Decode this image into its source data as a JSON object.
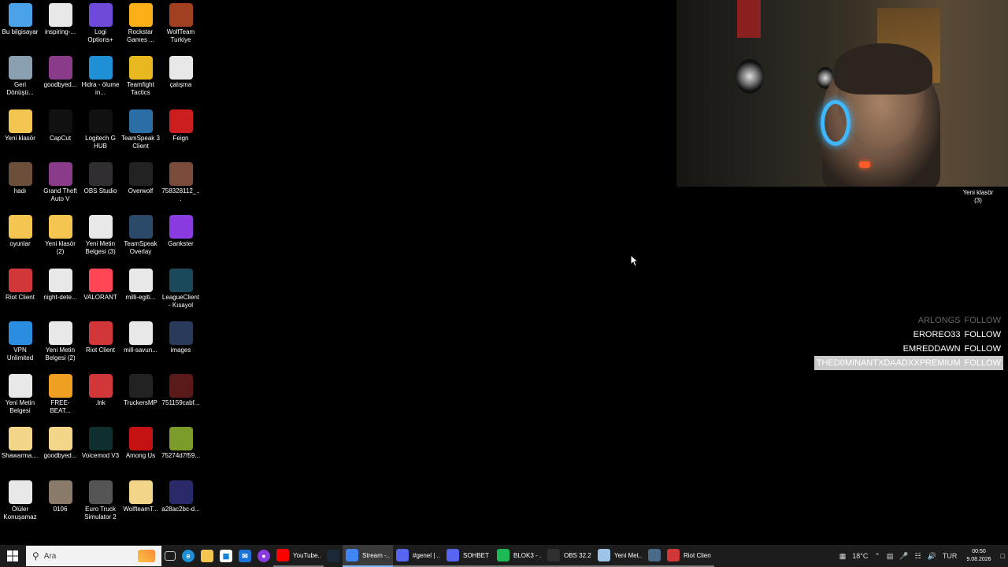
{
  "desktop": {
    "columns": [
      [
        {
          "label": "Bu bilgisayar",
          "icon": "computer-icon",
          "color": "#4aa3e8"
        },
        {
          "label": "Geri Dönüşü...",
          "icon": "recycle-bin-icon",
          "color": "#8aa0b0"
        },
        {
          "label": "Yeni klasör",
          "icon": "folder-icon",
          "color": "#f4c550"
        },
        {
          "label": "hadı",
          "icon": "image-icon",
          "color": "#6b4f3a"
        },
        {
          "label": "oyunlar",
          "icon": "folder-icon",
          "color": "#f4c550"
        },
        {
          "label": "Riot Client",
          "icon": "riot-icon",
          "color": "#d13639"
        },
        {
          "label": "VPN Unlimited",
          "icon": "vpn-icon",
          "color": "#2b8de0"
        },
        {
          "label": "Yeni Metin Belgesi",
          "icon": "text-file-icon",
          "color": "#e8e8e8"
        },
        {
          "label": "Shawarma....",
          "icon": "folder-icon",
          "color": "#f4d68a"
        },
        {
          "label": "Ölüler Konuşamaz",
          "icon": "video-icon",
          "color": "#e8e8e8"
        }
      ],
      [
        {
          "label": "inspiring-...",
          "icon": "video-icon",
          "color": "#e8e8e8"
        },
        {
          "label": "goodbyed...",
          "icon": "winrar-icon",
          "color": "#8a3b8a"
        },
        {
          "label": "CapCut",
          "icon": "capcut-icon",
          "color": "#111"
        },
        {
          "label": "Grand Theft Auto V",
          "icon": "winrar-icon",
          "color": "#8a3b8a"
        },
        {
          "label": "Yeni klasör (2)",
          "icon": "folder-icon",
          "color": "#f4c550"
        },
        {
          "label": "night-dete...",
          "icon": "video-icon",
          "color": "#e8e8e8"
        },
        {
          "label": "Yeni Metin Belgesi (2)",
          "icon": "text-file-icon",
          "color": "#e8e8e8"
        },
        {
          "label": "FREE-BEAT...",
          "icon": "image-icon",
          "color": "#f0a020"
        },
        {
          "label": "goodbyed...",
          "icon": "folder-icon",
          "color": "#f4d68a"
        },
        {
          "label": "0106",
          "icon": "image-icon",
          "color": "#8a7a6a"
        }
      ],
      [
        {
          "label": "Logi Options+",
          "icon": "logi-icon",
          "color": "#6f4ad8"
        },
        {
          "label": "Hidra - ölume in...",
          "icon": "edge-icon",
          "color": "#1f8fd6"
        },
        {
          "label": "Logitech G HUB",
          "icon": "logitech-g-icon",
          "color": "#111"
        },
        {
          "label": "OBS Studio",
          "icon": "obs-icon",
          "color": "#302e31"
        },
        {
          "label": "Yeni Metin Belgesi (3)",
          "icon": "text-file-icon",
          "color": "#e8e8e8"
        },
        {
          "label": "VALORANT",
          "icon": "valorant-icon",
          "color": "#ff4655"
        },
        {
          "label": "Riot Client",
          "icon": "riot-icon",
          "color": "#d13639"
        },
        {
          "label": ".lnk",
          "icon": "riot-icon",
          "color": "#d13639"
        },
        {
          "label": "Voicemod V3",
          "icon": "voicemod-icon",
          "color": "#0f2f2f"
        },
        {
          "label": "Euro Truck Simulator 2",
          "icon": "truck-icon",
          "color": "#555"
        }
      ],
      [
        {
          "label": "Rockstar Games ...",
          "icon": "rockstar-icon",
          "color": "#fcaf17"
        },
        {
          "label": "Teamfight Tactics",
          "icon": "tft-icon",
          "color": "#e8b820"
        },
        {
          "label": "TeamSpeak 3 Client",
          "icon": "teamspeak-icon",
          "color": "#2b6ea6"
        },
        {
          "label": "Overwolf",
          "icon": "overwolf-icon",
          "color": "#222"
        },
        {
          "label": "TeamSpeak Overlay",
          "icon": "teamspeak-icon",
          "color": "#2b4a6a"
        },
        {
          "label": "milli-egiti...",
          "icon": "pdf-icon",
          "color": "#e8e8e8"
        },
        {
          "label": "mill-savun...",
          "icon": "pdf-icon",
          "color": "#e8e8e8"
        },
        {
          "label": "TruckersMP",
          "icon": "truckersmp-icon",
          "color": "#222"
        },
        {
          "label": "Among Us",
          "icon": "among-us-icon",
          "color": "#c51111"
        },
        {
          "label": "WolfteamT...",
          "icon": "folder-icon",
          "color": "#f4d68a"
        }
      ],
      [
        {
          "label": "WolfTeam Turkiye",
          "icon": "wolfteam-icon",
          "color": "#a04020"
        },
        {
          "label": "çalışma",
          "icon": "text-file-icon",
          "color": "#e8e8e8"
        },
        {
          "label": "Feign",
          "icon": "feign-icon",
          "color": "#cc1e1e"
        },
        {
          "label": "758328112_...",
          "icon": "image-icon",
          "color": "#7a4a3a"
        },
        {
          "label": "Gankster",
          "icon": "gankster-icon",
          "color": "#8a3be0"
        },
        {
          "label": "LeagueClient - Kısayol",
          "icon": "league-icon",
          "color": "#1a4a5a"
        },
        {
          "label": "images",
          "icon": "image-icon",
          "color": "#2a3a5a"
        },
        {
          "label": "751159cabf...",
          "icon": "image-icon",
          "color": "#5a1a1a"
        },
        {
          "label": "75274d7f59...",
          "icon": "image-icon",
          "color": "#7a9a2a"
        },
        {
          "label": "a28ac2bc-d...",
          "icon": "image-icon",
          "color": "#2a2a6a"
        }
      ]
    ],
    "right_icon": {
      "label": "Yeni klasör (3)"
    }
  },
  "alerts": [
    {
      "name": "ARLONGS",
      "action": "FOLLOW",
      "style": "faded"
    },
    {
      "name": "EROREO33",
      "action": "FOLLOW",
      "style": "normal"
    },
    {
      "name": "EMREDDAWN",
      "action": "FOLLOW",
      "style": "normal"
    },
    {
      "name": "THED0MINANTXDAADXXPREMIUM",
      "action": "FOLLOW",
      "style": "highlight"
    }
  ],
  "taskbar": {
    "search_placeholder": "Ara",
    "apps": [
      {
        "label": "YouTube...",
        "icon": "youtube-icon",
        "color": "#ff0000",
        "state": "running"
      },
      {
        "label": "",
        "icon": "steam-icon",
        "color": "#1b2838",
        "state": "pinned"
      },
      {
        "label": "Stream -...",
        "icon": "chrome-icon",
        "color": "#4285f4",
        "state": "active"
      },
      {
        "label": "#genel | ...",
        "icon": "discord-icon",
        "color": "#5865f2",
        "state": "running"
      },
      {
        "label": "SOHBET ...",
        "icon": "discord-icon",
        "color": "#5865f2",
        "state": "running"
      },
      {
        "label": "BLOK3 - ...",
        "icon": "spotify-icon",
        "color": "#1db954",
        "state": "running"
      },
      {
        "label": "OBS 32.2...",
        "icon": "obs-icon",
        "color": "#302e31",
        "state": "running"
      },
      {
        "label": "Yeni Met...",
        "icon": "notepad-icon",
        "color": "#9ec5e8",
        "state": "running"
      },
      {
        "label": "",
        "icon": "settings-app-icon",
        "color": "#4a6a8a",
        "state": "running"
      },
      {
        "label": "Riot Client",
        "icon": "riot-icon",
        "color": "#d13639",
        "state": "running"
      }
    ],
    "weather": "18°C",
    "language": "TUR",
    "time": "00:50",
    "date": "9.08.2026"
  }
}
